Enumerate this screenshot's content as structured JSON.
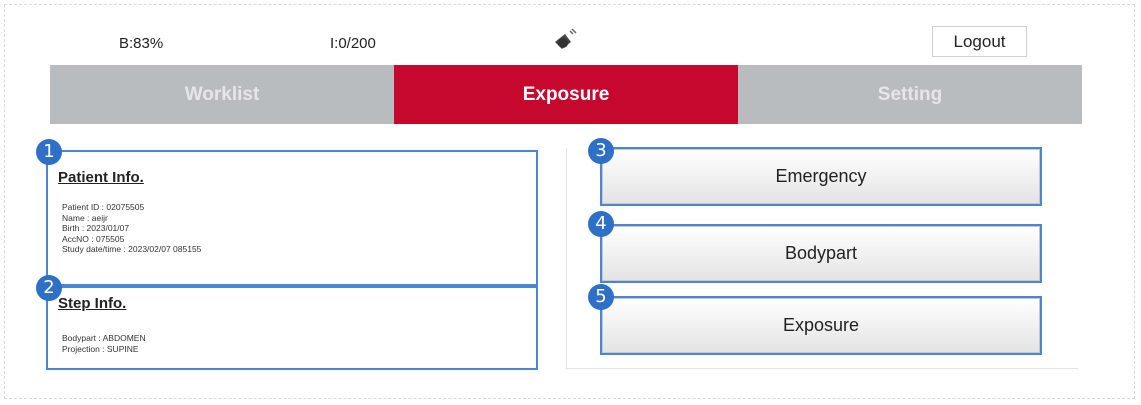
{
  "status": {
    "battery": "B:83%",
    "images": "I:0/200",
    "signal_icon": "signal-icon"
  },
  "header": {
    "logout_label": "Logout"
  },
  "tabs": [
    {
      "label": "Worklist",
      "active": false
    },
    {
      "label": "Exposure",
      "active": true
    },
    {
      "label": "Setting",
      "active": false
    }
  ],
  "patient_info": {
    "title": "Patient Info.",
    "lines": [
      "Patient ID : 02075505",
      "Name : aeijr",
      "Birth : 2023/01/07",
      "AccNO : 075505",
      "Study date/time : 2023/02/07 085155"
    ]
  },
  "step_info": {
    "title": "Step Info.",
    "lines": [
      "Bodypart : ABDOMEN",
      "Projection : SUPINE"
    ]
  },
  "actions": {
    "emergency": "Emergency",
    "bodypart": "Bodypart",
    "exposure": "Exposure"
  },
  "badges": [
    "1",
    "2",
    "3",
    "4",
    "5"
  ],
  "colors": {
    "accent": "#c6082e",
    "tab_inactive": "#b9bcbf",
    "highlight": "#4a86d4",
    "badge": "#2e6fc7"
  }
}
